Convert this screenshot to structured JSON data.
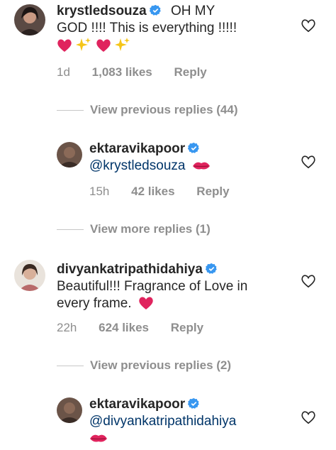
{
  "comments": [
    {
      "username": "krystledsouza",
      "text_line1": "OH MY",
      "text_line2": "GOD !!!! This is everything !!!!!",
      "age": "1d",
      "likes": "1,083 likes",
      "reply": "Reply"
    },
    {
      "username": "ektaravikapoor",
      "mention": "@krystledsouza",
      "age": "15h",
      "likes": "42 likes",
      "reply": "Reply"
    },
    {
      "username": "divyankatripathidahiya",
      "text_line1": "Beautiful!!! Fragrance of Love in",
      "text_line2": "every frame.",
      "age": "22h",
      "likes": "624 likes",
      "reply": "Reply"
    },
    {
      "username": "ektaravikapoor",
      "mention": "@divyankatripathidahiya"
    }
  ],
  "view_replies": [
    "View previous replies (44)",
    "View more replies (1)",
    "View previous replies (2)"
  ],
  "colors": {
    "verified": "#3897f0",
    "heart_emoji": "#e0245e",
    "meta": "#8e8e8e",
    "mention": "#003569"
  },
  "icons": [
    "heart-outline-icon",
    "verified-badge-icon",
    "red-heart-emoji",
    "sparkles-emoji",
    "kiss-mark-emoji"
  ]
}
